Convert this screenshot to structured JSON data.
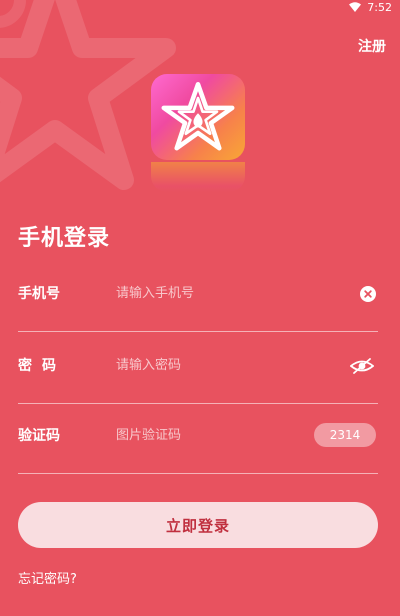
{
  "status_bar": {
    "time": "7:52"
  },
  "header": {
    "register_label": "注册"
  },
  "page_title": "手机登录",
  "form": {
    "phone": {
      "label": "手机号",
      "placeholder": "请输入手机号",
      "value": ""
    },
    "password": {
      "label": "密码",
      "placeholder": "请输入密码",
      "value": ""
    },
    "captcha": {
      "label": "验证码",
      "placeholder": "图片验证码",
      "value": "",
      "code": "2314"
    }
  },
  "login_button_label": "立即登录",
  "forgot_password_label": "忘记密码?",
  "colors": {
    "background": "#e8525f",
    "button_background": "#f9dde0",
    "button_text": "#c0303f"
  }
}
